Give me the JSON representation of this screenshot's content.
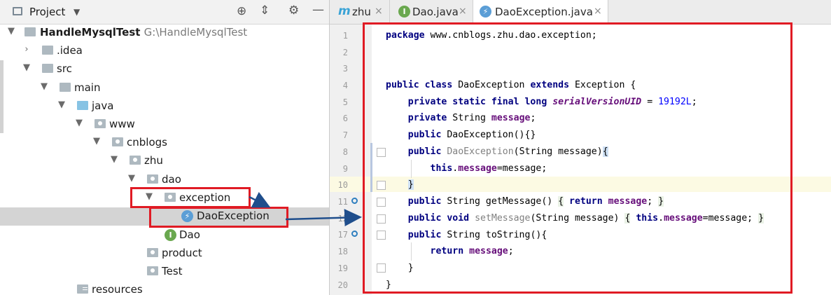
{
  "project_panel": {
    "title": "Project",
    "tree": [
      {
        "id": "root",
        "name": "HandleMysqlTest",
        "path": "G:\\HandleMysqlTest"
      },
      {
        "id": "idea",
        "name": ".idea"
      },
      {
        "id": "src",
        "name": "src"
      },
      {
        "id": "main",
        "name": "main"
      },
      {
        "id": "java",
        "name": "java"
      },
      {
        "id": "www",
        "name": "www"
      },
      {
        "id": "cnblogs",
        "name": "cnblogs"
      },
      {
        "id": "zhu",
        "name": "zhu"
      },
      {
        "id": "dao",
        "name": "dao"
      },
      {
        "id": "exception",
        "name": "exception"
      },
      {
        "id": "daoexception",
        "name": "DaoException",
        "selected": true
      },
      {
        "id": "daoclass",
        "name": "Dao"
      },
      {
        "id": "product",
        "name": "product"
      },
      {
        "id": "test",
        "name": "Test"
      },
      {
        "id": "resources",
        "name": "resources"
      }
    ]
  },
  "tabs": [
    {
      "label": "zhu",
      "icon": "m"
    },
    {
      "label": "Dao.java",
      "icon": "I"
    },
    {
      "label": "DaoException.java",
      "icon": "lightning",
      "active": true
    }
  ],
  "editor": {
    "line_numbers": [
      "1",
      "2",
      "3",
      "4",
      "5",
      "6",
      "7",
      "8",
      "9",
      "10",
      "11",
      "12",
      "17",
      "18",
      "19",
      "20"
    ],
    "lines": [
      "package www.cnblogs.zhu.dao.exception;",
      "",
      "",
      "public class DaoException extends Exception {",
      "    private static final long serialVersionUID = 19192L;",
      "    private String message;",
      "    public DaoException(){}",
      "    public DaoException(String message){",
      "        this.message=message;",
      "    }",
      "    public String getMessage() { return message; }",
      "    public void setMessage(String message) { this.message=message; }",
      "    public String toString(){",
      "        return message;",
      "    }",
      "}"
    ]
  },
  "colors": {
    "keyword": "#000080",
    "field": "#660e7a",
    "number": "#0000ff",
    "annotation_box": "#e01b24",
    "annotation_arrow": "#1f4e8c",
    "selection": "#d4d4d4",
    "current_line": "#fcfae3"
  }
}
